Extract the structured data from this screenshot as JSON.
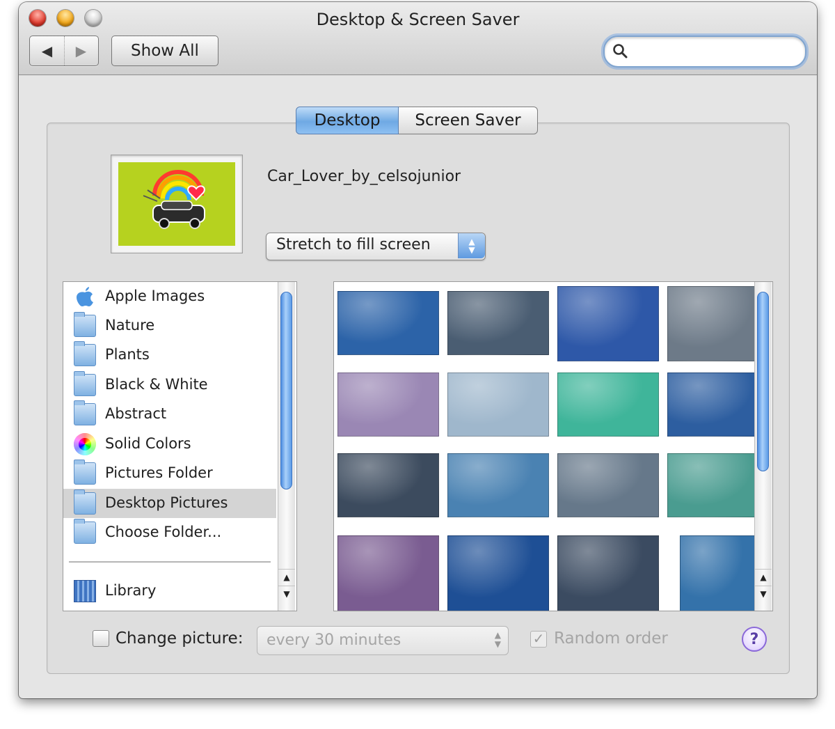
{
  "window": {
    "title": "Desktop & Screen Saver"
  },
  "toolbar": {
    "back_icon": "back-arrow-icon",
    "forward_icon": "forward-arrow-icon",
    "show_all_label": "Show All",
    "search": {
      "value": "",
      "placeholder": "",
      "icon": "magnifier-icon"
    }
  },
  "tabs": [
    {
      "label": "Desktop",
      "selected": true
    },
    {
      "label": "Screen Saver",
      "selected": false
    }
  ],
  "current_picture": {
    "name": "Car_Lover_by_celsojunior",
    "fit_mode": "Stretch to fill screen"
  },
  "sources": {
    "items": [
      {
        "label": "Apple Images",
        "icon": "apple-icon"
      },
      {
        "label": "Nature",
        "icon": "folder-icon"
      },
      {
        "label": "Plants",
        "icon": "folder-icon"
      },
      {
        "label": "Black & White",
        "icon": "folder-icon"
      },
      {
        "label": "Abstract",
        "icon": "folder-icon"
      },
      {
        "label": "Solid Colors",
        "icon": "color-wheel-icon"
      },
      {
        "label": "Pictures Folder",
        "icon": "pictures-folder-icon"
      },
      {
        "label": "Desktop Pictures",
        "icon": "folder-icon",
        "selected": true
      },
      {
        "label": "Choose Folder...",
        "icon": "folder-icon"
      }
    ],
    "library": {
      "label": "Library",
      "icon": "library-icon"
    }
  },
  "thumbnail_colors": [
    [
      "#2c63a8",
      "#4a5d72",
      "#2e58a8",
      "#6d7a88"
    ],
    [
      "#9a87b4",
      "#9fb7cc",
      "#3fb59a",
      "#2d5ea0"
    ],
    [
      "#3c4b5e",
      "#4a82b2",
      "#66788a",
      "#4a9c90"
    ],
    [
      "#7a5c91",
      "#1e4f95",
      "#3b4b61",
      "#3472aa"
    ]
  ],
  "bottom": {
    "change_picture_label": "Change picture:",
    "change_picture_checked": false,
    "interval": "every 30 minutes",
    "random_order_label": "Random order",
    "random_order_checked": true,
    "help_symbol": "?"
  },
  "colors": {
    "accent_blue": "#6fa9e4",
    "wallpaper_preview_bg": "#b6d21f"
  }
}
